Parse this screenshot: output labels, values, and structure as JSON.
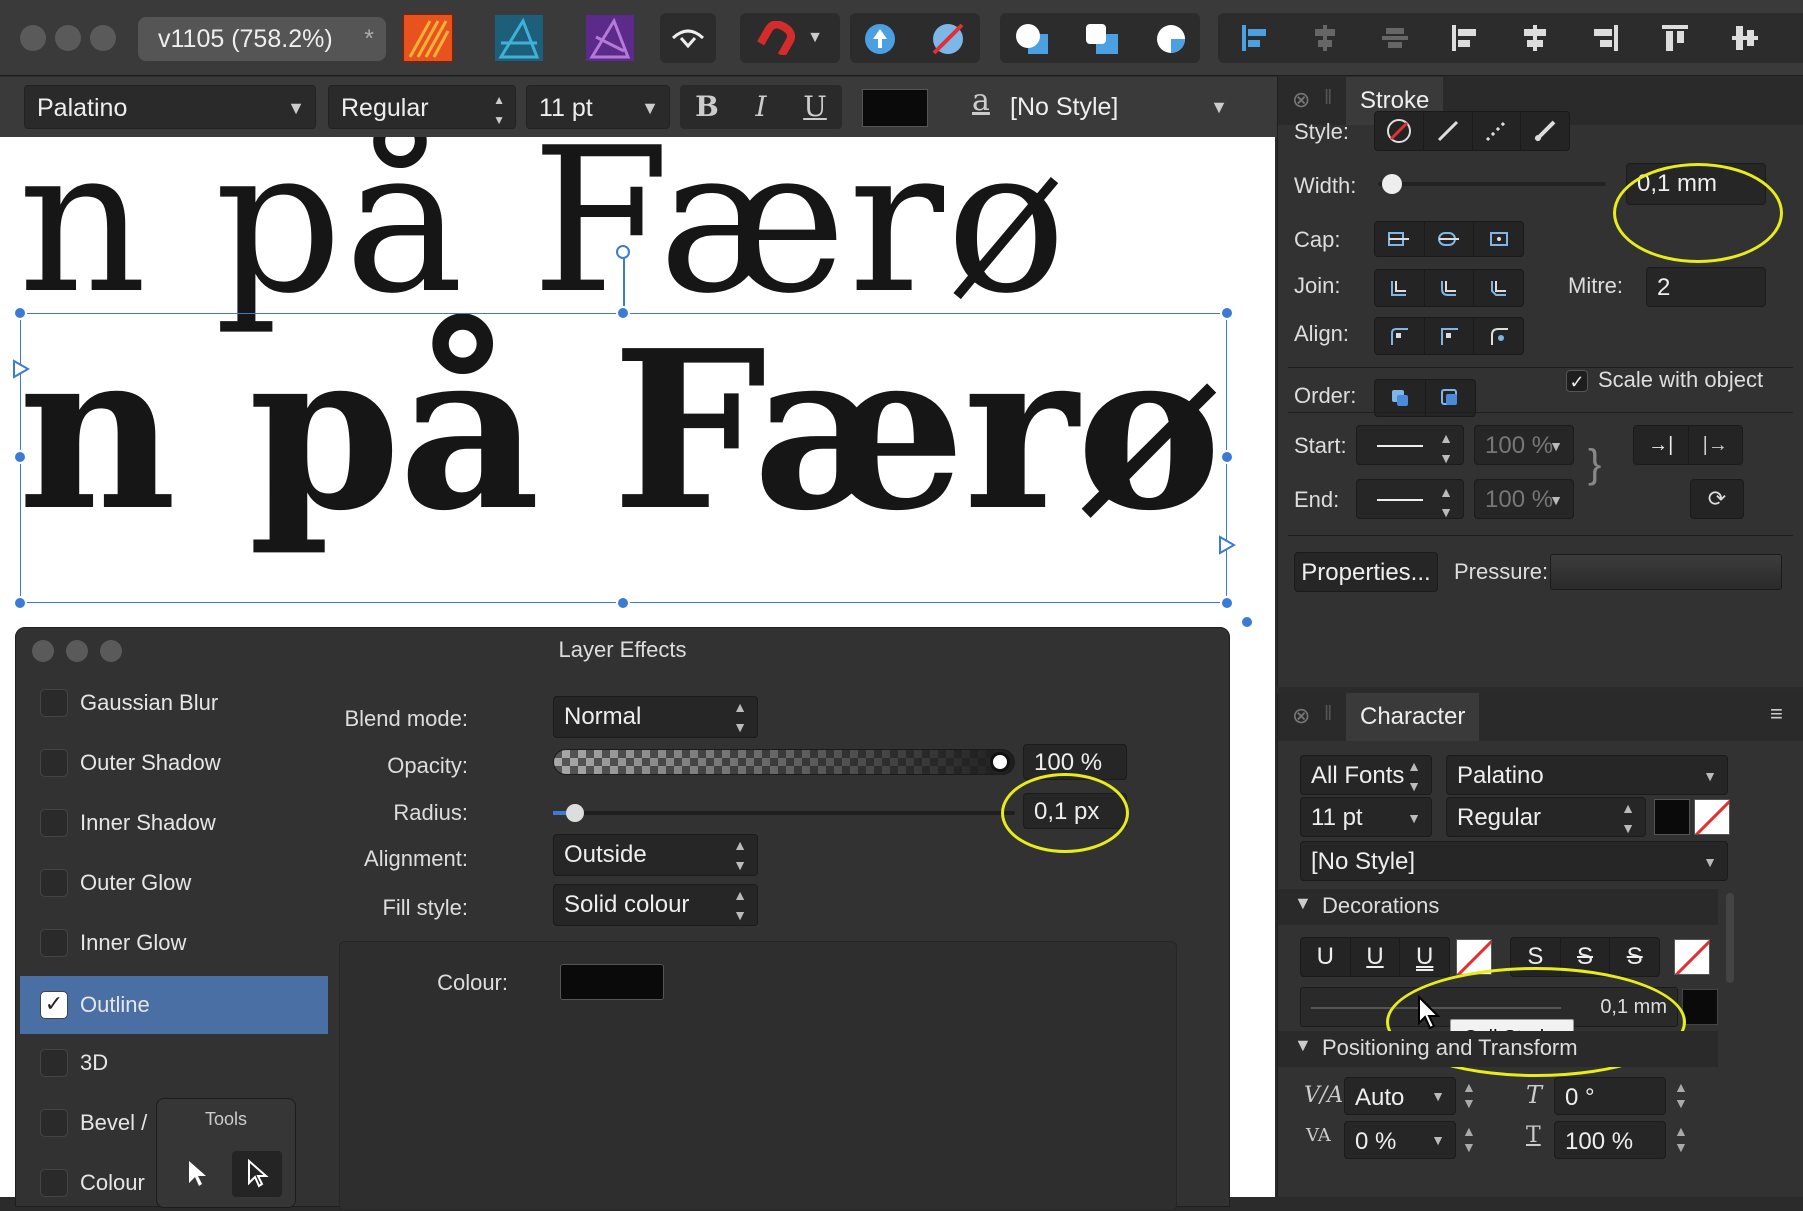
{
  "toolbar": {
    "doc_title": "v1105  (758.2%)",
    "modified_mark": "*",
    "app_icons": [
      "designer-persona-icon",
      "publisher-persona-icon",
      "photo-persona-icon"
    ]
  },
  "context_bar": {
    "font_family": "Palatino",
    "font_style": "Regular",
    "font_size": "11 pt",
    "bold": "B",
    "italic": "I",
    "underline": "U",
    "style_glyph": "a",
    "paragraph_style": "[No Style]"
  },
  "canvas": {
    "line_top": "n på Færø",
    "line_main": "n på Færø"
  },
  "layer_effects": {
    "title": "Layer Effects",
    "effects": [
      {
        "label": "Gaussian Blur",
        "checked": false
      },
      {
        "label": "Outer Shadow",
        "checked": false
      },
      {
        "label": "Inner Shadow",
        "checked": false
      },
      {
        "label": "Outer Glow",
        "checked": false
      },
      {
        "label": "Inner Glow",
        "checked": false
      },
      {
        "label": "Outline",
        "checked": true
      },
      {
        "label": "3D",
        "checked": false
      },
      {
        "label": "Bevel /",
        "checked": false
      },
      {
        "label": "Colour",
        "checked": false
      }
    ],
    "blend_mode_label": "Blend mode:",
    "blend_mode": "Normal",
    "opacity_label": "Opacity:",
    "opacity": "100 %",
    "opacity_fraction": 1.0,
    "radius_label": "Radius:",
    "radius": "0,1 px",
    "radius_fraction": 0.03,
    "alignment_label": "Alignment:",
    "alignment": "Outside",
    "fill_style_label": "Fill style:",
    "fill_style": "Solid colour",
    "colour_label": "Colour:",
    "colour_value": "#0a0a0a"
  },
  "tools_popover": {
    "title": "Tools"
  },
  "stroke_panel": {
    "tab": "Stroke",
    "style_label": "Style:",
    "width_label": "Width:",
    "width_value": "0,1 mm",
    "width_fraction": 0.02,
    "cap_label": "Cap:",
    "join_label": "Join:",
    "mitre_label": "Mitre:",
    "mitre_value": "2",
    "align_label": "Align:",
    "order_label": "Order:",
    "scale_with_object": "Scale with object",
    "scale_checked": true,
    "start_label": "Start:",
    "start_pct": "100 %",
    "end_label": "End:",
    "end_pct": "100 %",
    "properties_button": "Properties...",
    "pressure_label": "Pressure:"
  },
  "character_panel": {
    "tab": "Character",
    "font_collection": "All Fonts",
    "font_family": "Palatino",
    "font_size": "11 pt",
    "font_style": "Regular",
    "paragraph_style": "[No Style]",
    "decorations_header": "Decorations",
    "underline_glyphs": [
      "U",
      "U",
      "U"
    ],
    "strike_glyphs": [
      "S",
      "S",
      "S"
    ],
    "decoration_width": "0,1 mm",
    "tooltip": "Cell Stroke",
    "positioning_header": "Positioning and Transform",
    "tracking_value": "Auto",
    "shear_value": "0 °",
    "kerning_value": "0 %",
    "scale_value": "100 %"
  },
  "colors": {
    "accent": "#3b7bd4",
    "highlight_ring": "#e8ec1a",
    "selection": "#4a6fa5"
  }
}
